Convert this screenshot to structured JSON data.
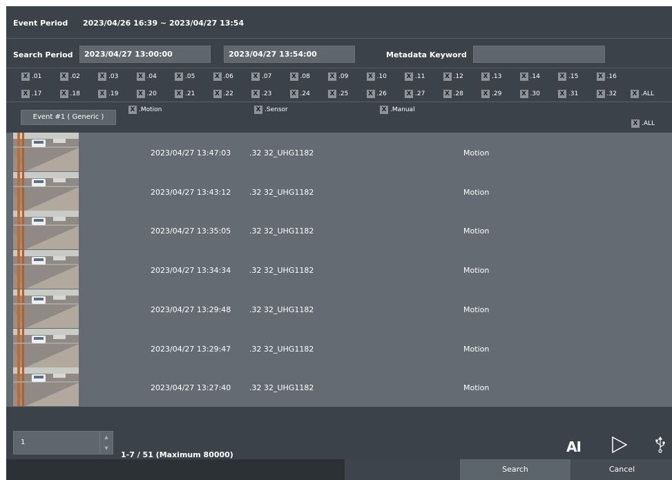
{
  "event_period": {
    "label": "Event Period",
    "value": "2023/04/26 16:39 ~ 2023/04/27 13:54"
  },
  "search_period": {
    "label": "Search Period",
    "start": "2023/04/27 13:00:00",
    "end": "2023/04/27 13:54:00"
  },
  "metadata": {
    "label": "Metadata Keyword",
    "value": ""
  },
  "check_mark": "X",
  "channels_row1": [
    ".01",
    ".02",
    ".03",
    ".04",
    ".05",
    ".06",
    ".07",
    ".08",
    ".09",
    ".10",
    ".11",
    ".12",
    ".13",
    ".14",
    ".15",
    ".16"
  ],
  "channels_row2": [
    ".17",
    ".18",
    ".19",
    ".20",
    ".21",
    ".22",
    ".23",
    ".24",
    ".25",
    ".26",
    ".27",
    ".28",
    ".29",
    ".30",
    ".31",
    ".32"
  ],
  "channels_all": ".ALL",
  "event_button": "Event #1 ( Generic )",
  "event_types": [
    ".Motion",
    ".Sensor",
    ".Manual"
  ],
  "event_types_all": ".ALL",
  "results": [
    {
      "time": "2023/04/27 13:47:03",
      "camera": ".32 32_UHG1182",
      "type": "Motion"
    },
    {
      "time": "2023/04/27 13:43:12",
      "camera": ".32 32_UHG1182",
      "type": "Motion"
    },
    {
      "time": "2023/04/27 13:35:05",
      "camera": ".32 32_UHG1182",
      "type": "Motion"
    },
    {
      "time": "2023/04/27 13:34:34",
      "camera": ".32 32_UHG1182",
      "type": "Motion"
    },
    {
      "time": "2023/04/27 13:29:48",
      "camera": ".32 32_UHG1182",
      "type": "Motion"
    },
    {
      "time": "2023/04/27 13:29:47",
      "camera": ".32 32_UHG1182",
      "type": "Motion"
    },
    {
      "time": "2023/04/27 13:27:40",
      "camera": ".32 32_UHG1182",
      "type": "Motion"
    }
  ],
  "pagination": {
    "page": "1",
    "info": "1-7 / 51 (Maximum 80000)"
  },
  "toolbar": {
    "ai_label": "AI",
    "play_icon": "play-icon",
    "usb_icon": "usb-icon"
  },
  "footer": {
    "search": "Search",
    "cancel": "Cancel"
  }
}
